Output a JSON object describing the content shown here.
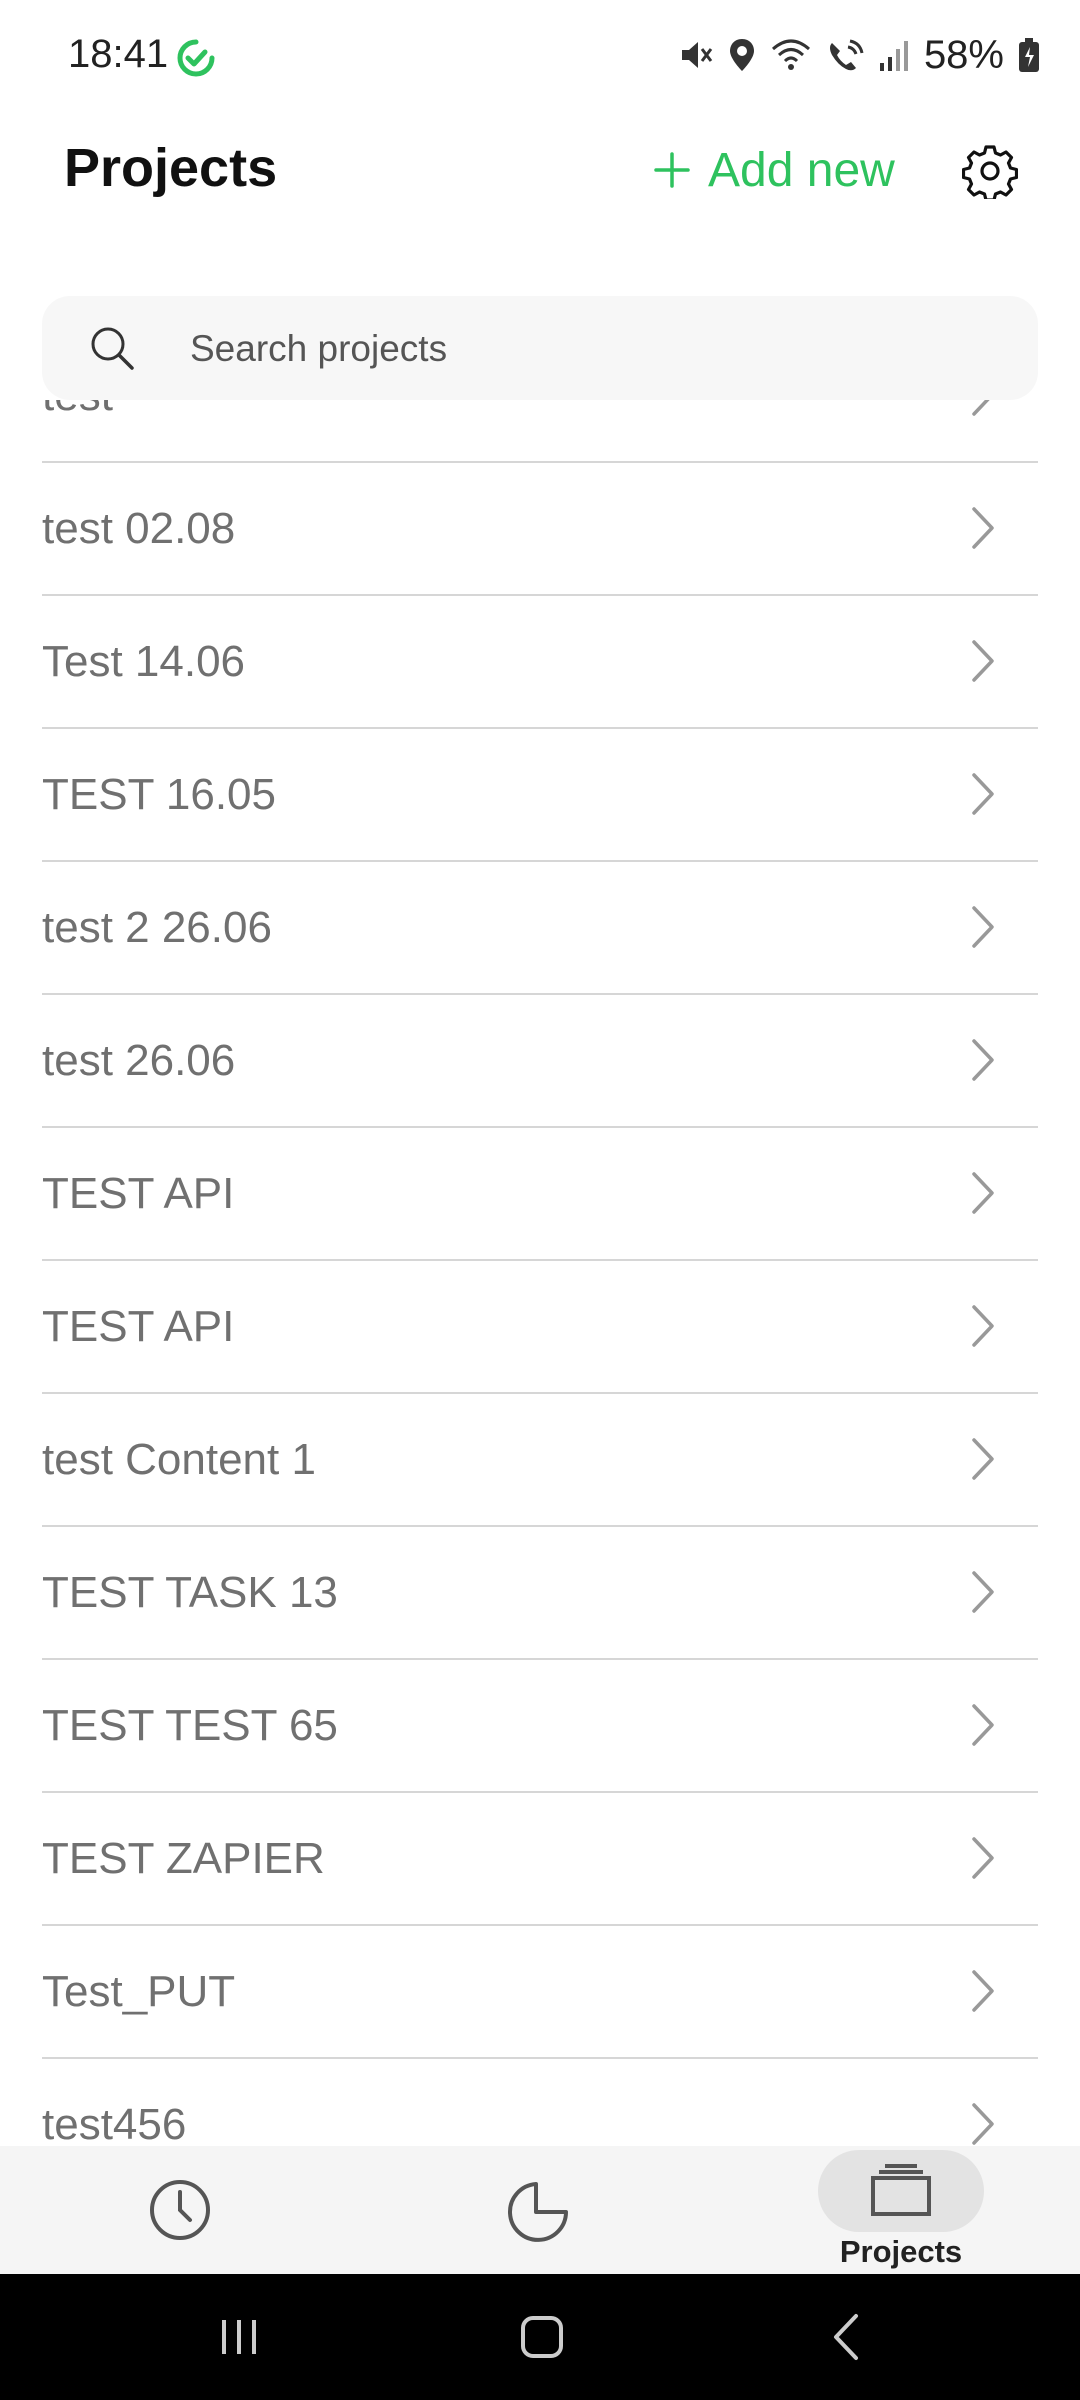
{
  "status_bar": {
    "time": "18:41",
    "battery": "58%",
    "icons": [
      "sync-check-icon",
      "mute-icon",
      "location-icon",
      "wifi-icon",
      "wifi-call-icon",
      "signal-icon",
      "battery-icon"
    ]
  },
  "header": {
    "title": "Projects",
    "add_new_label": "Add new",
    "settings_icon": "gear-icon"
  },
  "search": {
    "placeholder": "Search projects",
    "value": ""
  },
  "projects": [
    "test",
    "test 02.08",
    "Test 14.06",
    "TEST 16.05",
    "test 2 26.06",
    "test 26.06",
    "TEST API",
    "TEST API",
    "test Content 1",
    "TEST TASK 13",
    "TEST TEST 65",
    "TEST ZAPIER",
    "Test_PUT",
    "test456"
  ],
  "bottom_nav": {
    "items": [
      {
        "icon": "clock-icon",
        "label": ""
      },
      {
        "icon": "pie-chart-icon",
        "label": ""
      },
      {
        "icon": "folders-icon",
        "label": "Projects",
        "active": true
      }
    ]
  },
  "colors": {
    "accent": "#2ec25e",
    "list_text": "#707070",
    "divider": "#d6d6d6",
    "nav_bg": "#f5f5f5",
    "active_pill": "#e3e3e3"
  }
}
